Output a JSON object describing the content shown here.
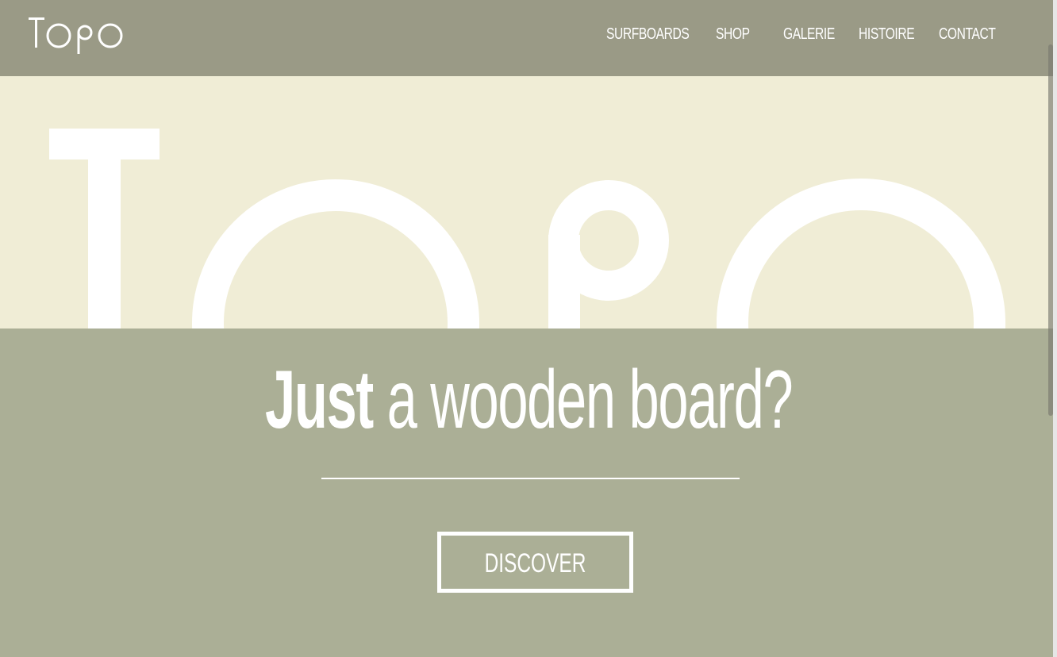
{
  "brand": {
    "logo_text": "TOPO"
  },
  "nav": {
    "items": [
      {
        "label": "SURFBOARDS"
      },
      {
        "label": "SHOP"
      },
      {
        "label": "GALERIE"
      },
      {
        "label": "HISTOIRE"
      },
      {
        "label": "CONTACT"
      }
    ]
  },
  "hero": {
    "background_wordmark": "TOPO"
  },
  "headline": {
    "bold": "Just",
    "rest": " a wooden board?"
  },
  "cta": {
    "label": "DISCOVER"
  },
  "colors": {
    "header_bg": "#9a9a86",
    "hero_bg": "#f0edd6",
    "content_bg": "#abaf96",
    "text": "#ffffff"
  }
}
